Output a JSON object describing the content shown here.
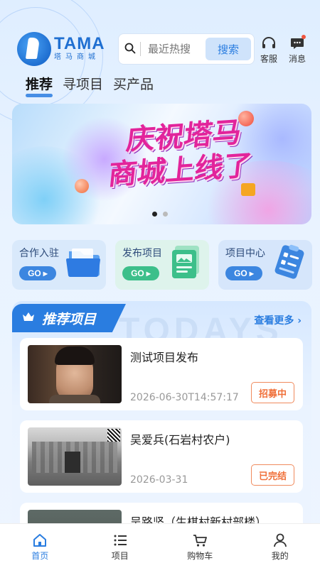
{
  "header": {
    "logo_en": "TAMA",
    "logo_cn": "塔马商城",
    "search_placeholder": "最近热搜",
    "search_button": "搜索",
    "service_label": "客服",
    "message_label": "消息"
  },
  "tabs": [
    {
      "label": "推荐",
      "active": true
    },
    {
      "label": "寻项目",
      "active": false
    },
    {
      "label": "买产品",
      "active": false
    }
  ],
  "banner": {
    "line1": "庆祝塔马",
    "line2": "商城上线了",
    "slide_count": 2,
    "active_slide": 1
  },
  "quick_entries": [
    {
      "label": "合作入驻",
      "go": "GO",
      "color": "#3c86e0",
      "bg": "#d9e9fb"
    },
    {
      "label": "发布项目",
      "go": "GO",
      "color": "#3cbf8a",
      "bg": "#def3ec"
    },
    {
      "label": "项目中心",
      "go": "GO",
      "color": "#3c86e0",
      "bg": "#d6e6fb"
    }
  ],
  "recommend": {
    "title": "推荐项目",
    "more": "查看更多",
    "watermark": "TODAYS",
    "items": [
      {
        "title": "测试项目发布",
        "date": "2026-06-30T14:57:17",
        "status": "招募中"
      },
      {
        "title": "吴爱兵(石岩村农户)",
        "date": "2026-03-31",
        "status": "已完结"
      },
      {
        "title": "吴路坚（生棋村新村部楼）",
        "date": "",
        "status": ""
      }
    ]
  },
  "bottom_nav": [
    {
      "label": "首页",
      "icon": "home-icon",
      "active": true
    },
    {
      "label": "项目",
      "icon": "list-icon",
      "active": false
    },
    {
      "label": "购物车",
      "icon": "cart-icon",
      "active": false
    },
    {
      "label": "我的",
      "icon": "user-icon",
      "active": false
    }
  ],
  "colors": {
    "primary": "#2a7de0",
    "badge": "#f0703a",
    "banner_text": "#e2249b"
  }
}
